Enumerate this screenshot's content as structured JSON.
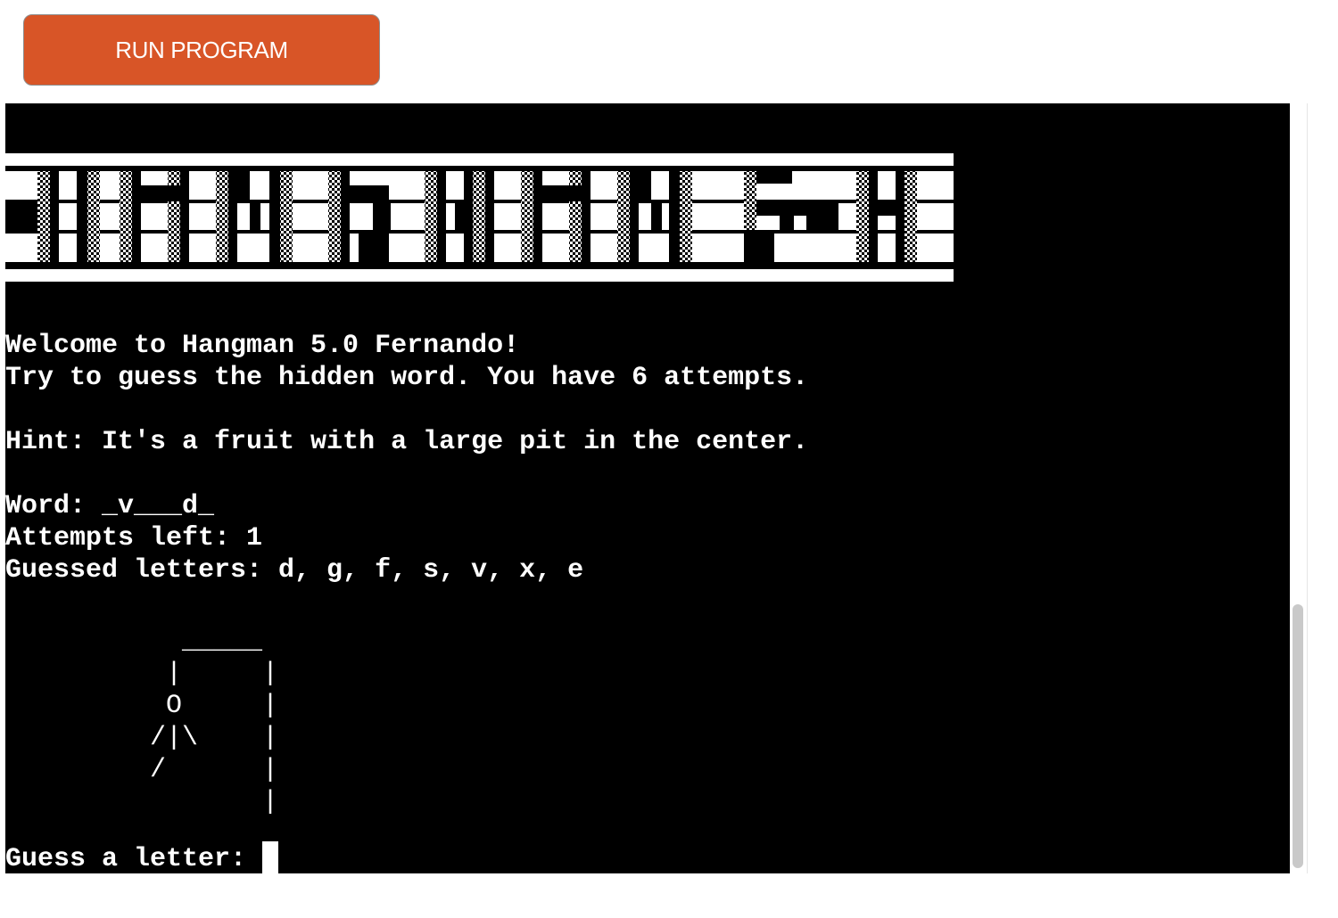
{
  "toolbar": {
    "run_label": "RUN PROGRAM"
  },
  "colors": {
    "button": "#d85527",
    "terminal_bg": "#000000",
    "terminal_fg": "#ffffff"
  },
  "terminal": {
    "banner_text": "HANGMAN 5.0",
    "welcome": "Welcome to Hangman 5.0 Fernando!",
    "instructions": "Try to guess the hidden word. You have 6 attempts.",
    "hint": "Hint: It's a fruit with a large pit in the center.",
    "word": "Word: _v___d_",
    "attempts": "Attempts left: 1",
    "guessed": "Guessed letters: d, g, f, s, v, x, e",
    "gallows_art": "           _____\n          |     |\n          O     |\n         /|\\    |\n         /      |\n                |",
    "prompt": "Guess a letter: "
  }
}
